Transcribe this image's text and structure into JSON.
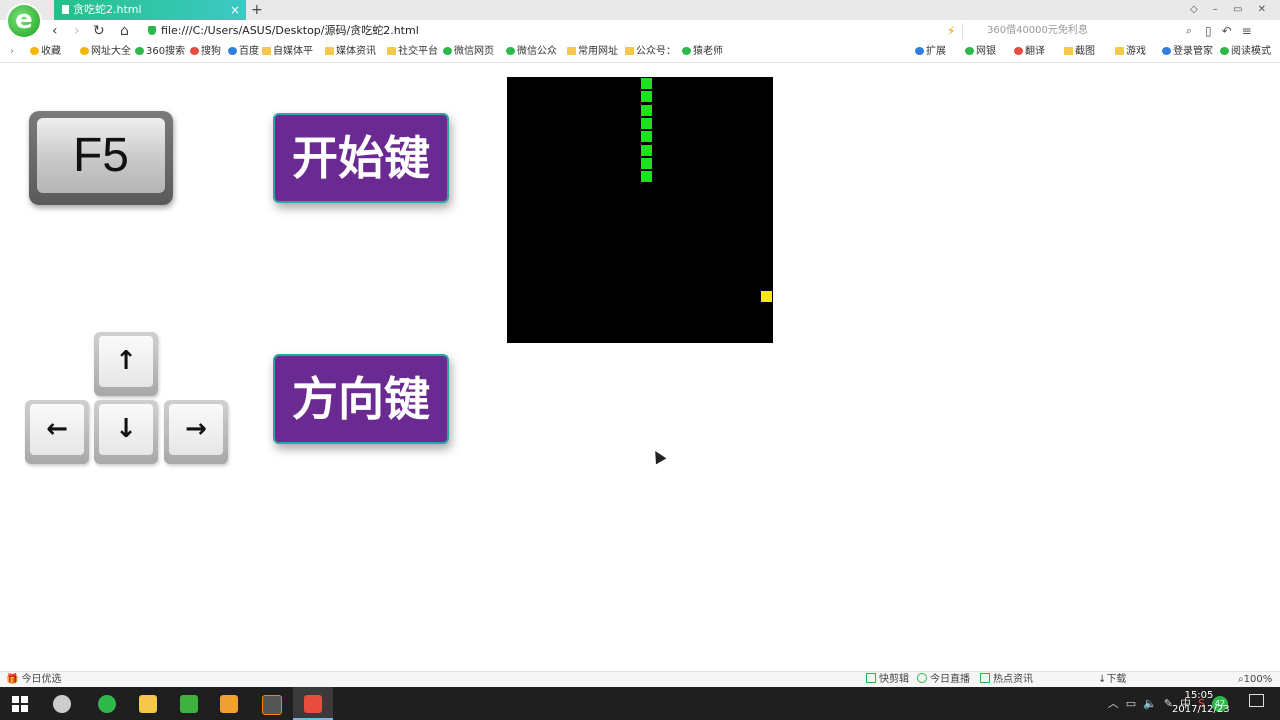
{
  "browser": {
    "tab_title": "贪吃蛇2.html",
    "tab_close": "×",
    "new_tab": "+",
    "url": "file:///C:/Users/ASUS/Desktop/源码/贪吃蛇2.html",
    "search_placeholder": "360借40000元免利息",
    "nav": {
      "back": "‹",
      "forward": "›",
      "refresh": "↻",
      "home": "⌂"
    },
    "bookmarks": [
      {
        "label": "收藏",
        "icon": "star-icon"
      },
      {
        "label": "网址大全",
        "icon": "globe-icon"
      },
      {
        "label": "360搜索",
        "icon": "search-360-icon"
      },
      {
        "label": "搜狗",
        "icon": "sogou-icon"
      },
      {
        "label": "百度",
        "icon": "baidu-icon"
      },
      {
        "label": "自媒体平",
        "icon": "folder-icon"
      },
      {
        "label": "媒体资讯",
        "icon": "folder-icon"
      },
      {
        "label": "社交平台",
        "icon": "folder-icon"
      },
      {
        "label": "微信网页",
        "icon": "wechat-icon"
      },
      {
        "label": "微信公众",
        "icon": "wechat-icon"
      },
      {
        "label": "常用网址",
        "icon": "folder-icon"
      },
      {
        "label": "公众号：",
        "icon": "folder-icon"
      },
      {
        "label": "猿老师",
        "icon": "wechat-icon"
      }
    ],
    "bookmark_tools": [
      {
        "label": "扩展"
      },
      {
        "label": "网银"
      },
      {
        "label": "翻译"
      },
      {
        "label": "截图"
      },
      {
        "label": "游戏"
      },
      {
        "label": "登录管家"
      },
      {
        "label": "阅读模式"
      }
    ]
  },
  "page": {
    "f5_key": "F5",
    "start_button": "开始键",
    "direction_button": "方向键",
    "arrows": {
      "up": "↑",
      "left": "←",
      "down": "↓",
      "right": "→"
    }
  },
  "game": {
    "board_color": "#000000",
    "snake_color": "#1de21d",
    "food_color": "#f5e80c",
    "grid_size": 20,
    "snake": [
      [
        10,
        0
      ],
      [
        10,
        1
      ],
      [
        10,
        2
      ],
      [
        10,
        3
      ],
      [
        10,
        4
      ],
      [
        10,
        5
      ],
      [
        10,
        6
      ],
      [
        10,
        7
      ]
    ],
    "food": [
      19,
      16
    ]
  },
  "statusbar": {
    "left": "今日优选",
    "items": [
      "快剪辑",
      "今日直播",
      "热点资讯",
      "下载"
    ],
    "zoom": "100%"
  },
  "taskbar": {
    "time": "15:05",
    "date": "2017/12/23",
    "ime": "中",
    "badge": "42"
  }
}
